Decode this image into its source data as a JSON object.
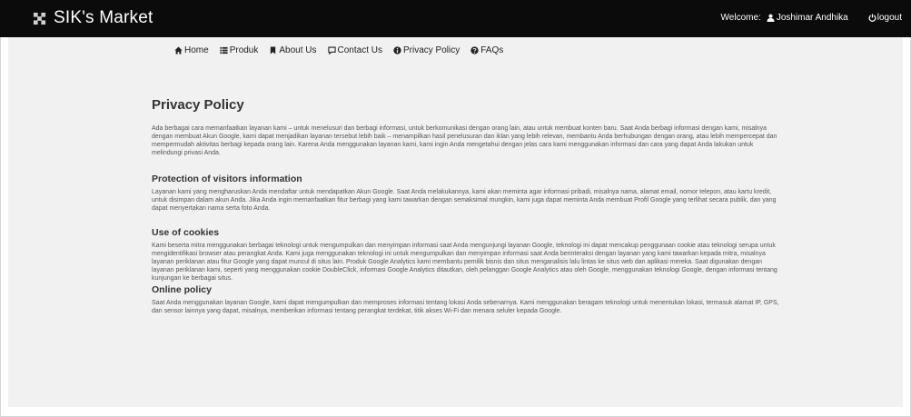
{
  "header": {
    "brand_title": "SIK's Market",
    "welcome_label": "Welcome:",
    "username": "Joshimar Andhika",
    "logout_label": "logout"
  },
  "nav": {
    "items": [
      {
        "label": "Home",
        "icon": "home-icon"
      },
      {
        "label": "Produk",
        "icon": "list-icon"
      },
      {
        "label": "About Us",
        "icon": "bookmark-icon"
      },
      {
        "label": "Contact Us",
        "icon": "comment-icon"
      },
      {
        "label": "Privacy Policy",
        "icon": "info-circle-icon"
      },
      {
        "label": "FAQs",
        "icon": "question-circle-icon"
      }
    ]
  },
  "page": {
    "title": "Privacy Policy",
    "intro": "Ada berbagai cara memanfaatkan layanan kami – untuk menelusuri dan berbagi informasi, untuk berkomunikasi dengan orang lain, atau untuk membuat konten baru. Saat Anda berbagi informasi dengan kami, misalnya dengan membuat Akun Google, kami dapat menjadikan layanan tersebut lebih baik – menampilkan hasil penelusuran dan iklan yang lebih relevan, membantu Anda berhubungan dengan orang, atau lebih mempercepat dan mempermudah aktivitas berbagi kepada orang lain. Karena Anda menggunakan layanan kami, kami ingin Anda mengetahui dengan jelas cara kami menggunakan informasi dan cara yang dapat Anda lakukan untuk melindungi privasi Anda.",
    "sections": [
      {
        "heading": "Protection of visitors information",
        "body": "Layanan kami yang mengharuskan Anda mendaftar untuk mendapatkan Akun Google. Saat Anda melakukannya, kami akan meminta agar informasi pribadi, misalnya nama, alamat email, nomor telepon, atau kartu kredit, untuk disimpan dalam akun Anda. Jika Anda ingin memanfaatkan fitur berbagi yang kami tawarkan dengan semaksimal mungkin, kami juga dapat meminta Anda membuat Profil Google yang terlihat secara publik, dan yang dapat menyertakan nama serta foto Anda."
      },
      {
        "heading": "Use of cookies",
        "body": "Kami beserta mitra menggunakan berbagai teknologi untuk mengumpulkan dan menyimpan informasi saat Anda mengunjungi layanan Google, teknologi ini dapat mencakup penggunaan cookie atau teknologi serupa untuk mengidentifikasi browser atau perangkat Anda. Kami juga menggunakan teknologi ini untuk mengumpulkan dan menyimpan informasi saat Anda berinteraksi dengan layanan yang kami tawarkan kepada mitra, misalnya layanan periklanan atau fitur Google yang dapat muncul di situs lain. Produk Google Analytics kami membantu pemilik bisnis dan situs menganalisis lalu lintas ke situs web dan aplikasi mereka. Saat digunakan dengan layanan periklanan kami, seperti yang menggunakan cookie DoubleClick, informasi Google Analytics ditautkan, oleh pelanggan Google Analytics atau oleh Google, menggunakan teknologi Google, dengan informasi tentang kunjungan ke berbagai situs."
      },
      {
        "heading": "Online policy",
        "body": "Saat Anda menggunakan layanan Google, kami dapat mengumpulkan dan memproses informasi tentang lokasi Anda sebenarnya. Kami menggunakan beragam teknologi untuk menentukan lokasi, termasuk alamat IP, GPS, dan sensor lainnya yang dapat, misalnya, memberikan informasi tentang perangkat terdekat, titik akses Wi-Fi dan menara seluler kepada Google."
      }
    ]
  },
  "colors": {
    "topbar": "#0b0b0b",
    "content_background": "#f1f1f1",
    "text": "#333333"
  }
}
